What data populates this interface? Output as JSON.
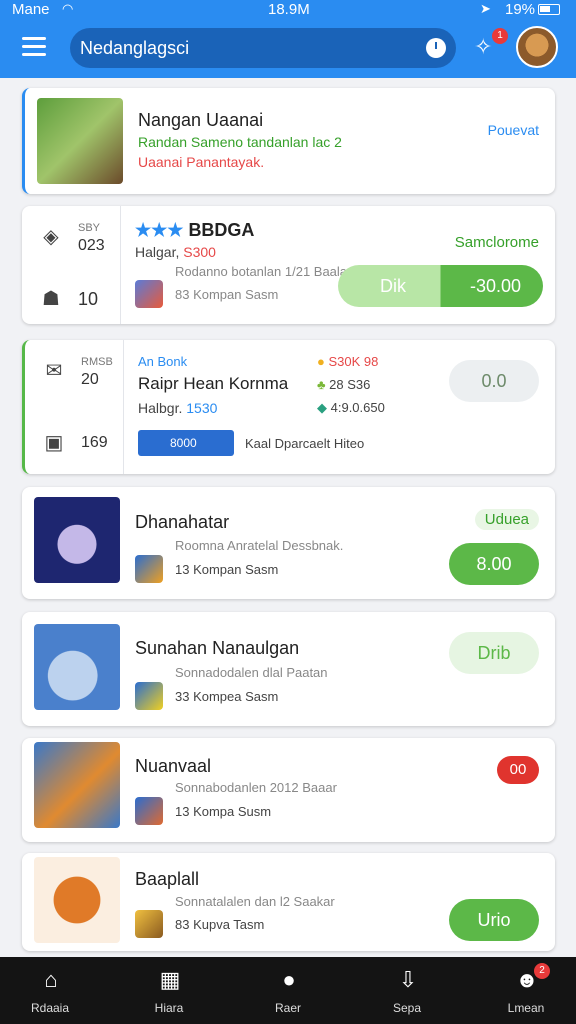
{
  "status": {
    "carrier": "Mane",
    "time": "18.9M",
    "battery": "19%"
  },
  "header": {
    "search_text": "Nedanglagsci",
    "notification_count": "1"
  },
  "colors": {
    "primary": "#2a8cf1",
    "green": "#5cb848",
    "red": "#e0342e",
    "nav_bg": "#141414"
  },
  "cards": [
    {
      "title": "Nangan Uaanai",
      "line1": "Randan Sameno tandanlan lac 2",
      "line2": "Uaanai Panantayak.",
      "tag": "Pouevat"
    },
    {
      "stat1_label": "SBY",
      "stat1_value": "023",
      "stat2_value": "10",
      "title_stars": "★★★",
      "title": "BBDGA",
      "price_label": "Halgar,",
      "price_value": "S300",
      "sub": "Rodanno botanlan 1/21 Baala",
      "seller": "83 Kompan Sasm",
      "tag": "Samclorome",
      "btn_left": "Dik",
      "btn_right": "-30.00"
    },
    {
      "stat1_label": "RMSB",
      "stat1_value": "20",
      "stat2_value": "169",
      "kicker": "An Bonk",
      "title": "Raipr Hean Kornma",
      "price_label": "Halbgr.",
      "price_value": "1530",
      "spec1": "S30K 98",
      "spec2": "28 S36",
      "spec3": "4:9.0.650",
      "chip": "8000",
      "seller": "Kaal Dparcaelt Hiteo",
      "btn": "0.0"
    },
    {
      "title": "Dhanahatar",
      "sub": "Roomna Anratelal Dessbnak.",
      "seller": "13 Kompan Sasm",
      "tag": "Uduea",
      "btn": "8.00"
    },
    {
      "title": "Sunahan Nanaulgan",
      "sub": "Sonnadodalen dlal Paatan",
      "seller": "33 Kompea Sasm",
      "btn": "Drib"
    },
    {
      "title": "Nuanvaal",
      "sub": "Sonnabodanlen 2012 Baaar",
      "seller": "13 Kompa Susm",
      "btn": "00"
    },
    {
      "title": "Baaplall",
      "sub": "Sonnatalalen dan l2 Saakar",
      "seller": "83 Kupva Tasm",
      "btn": "Urio"
    }
  ],
  "nav": [
    {
      "label": "Rdaaia",
      "icon": "home-icon"
    },
    {
      "label": "Hiara",
      "icon": "store-icon"
    },
    {
      "label": "Raer",
      "icon": "game-icon"
    },
    {
      "label": "Sepa",
      "icon": "download-icon"
    },
    {
      "label": "Lmean",
      "icon": "profile-icon",
      "badge": "2"
    }
  ]
}
